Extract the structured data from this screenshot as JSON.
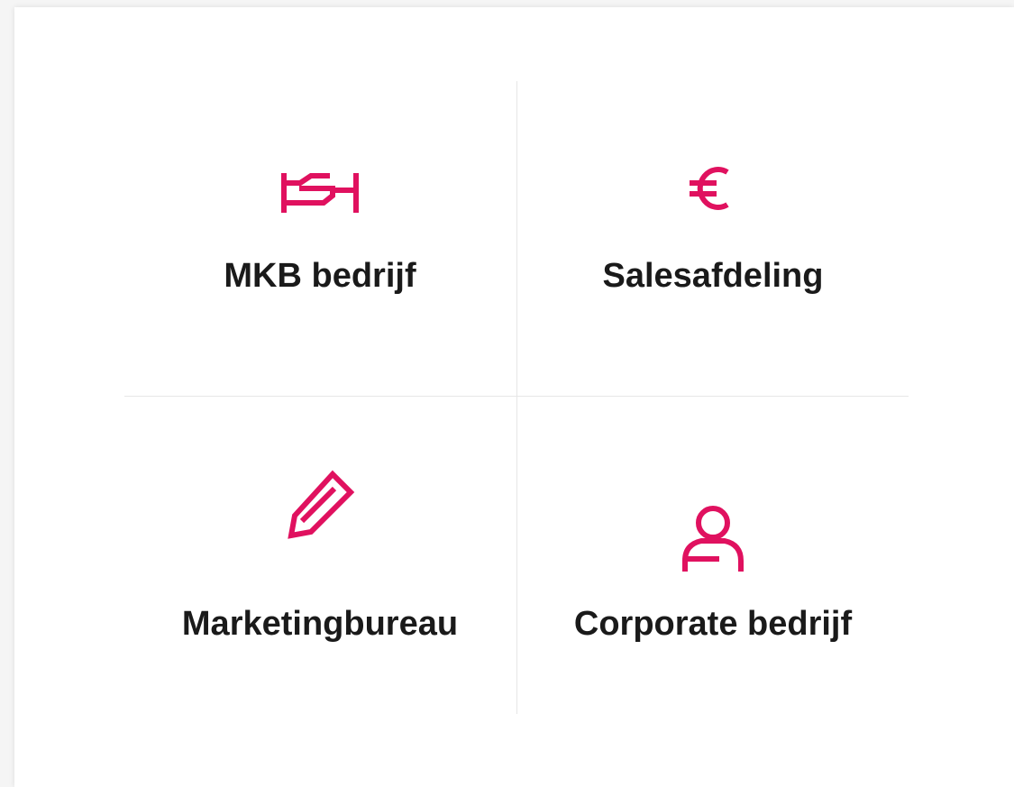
{
  "accent_color": "#e0115f",
  "options": [
    {
      "label": "MKB bedrijf",
      "icon": "handshake-icon"
    },
    {
      "label": "Salesafdeling",
      "icon": "euro-icon"
    },
    {
      "label": "Marketingbureau",
      "icon": "pencil-icon"
    },
    {
      "label": "Corporate bedrijf",
      "icon": "person-icon"
    }
  ]
}
